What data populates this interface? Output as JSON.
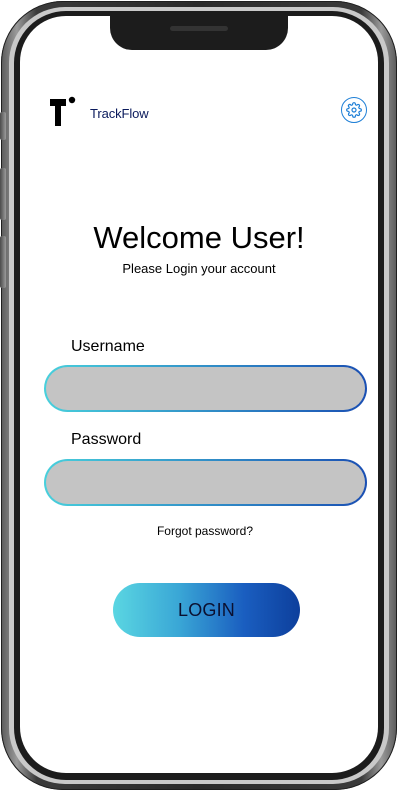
{
  "app": {
    "brand_name": "TrackFlow",
    "accent_color": "#1e7fd6",
    "text_color": "#0a1a5c"
  },
  "header": {
    "logo_icon": "trackflow-logo-icon",
    "settings_icon": "gear-icon"
  },
  "welcome": {
    "title": "Welcome User!",
    "subtitle": "Please Login your account"
  },
  "form": {
    "username_label": "Username",
    "username_value": "",
    "password_label": "Password",
    "password_value": "",
    "forgot_label": "Forgot password?",
    "login_label": "LOGIN",
    "field_fill": "#c4c4c4",
    "gradient_start": "#48d0dc",
    "gradient_end": "#1a4fb3"
  }
}
